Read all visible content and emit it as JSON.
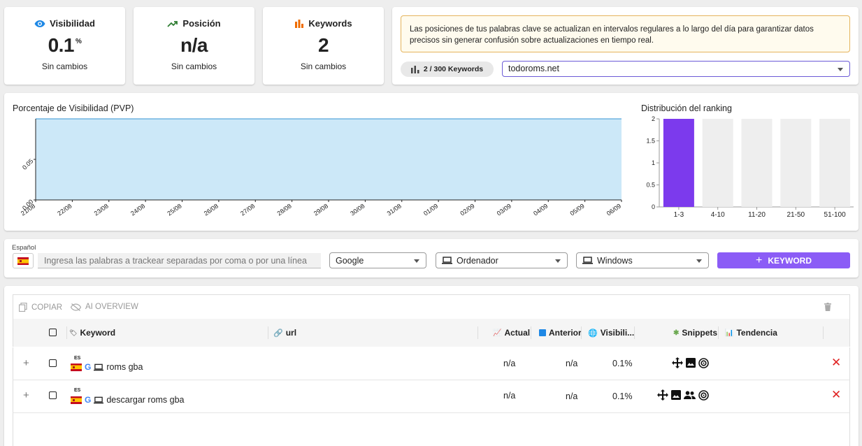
{
  "stats": [
    {
      "title": "Visibilidad",
      "value": "0.1",
      "unit": "%",
      "sub": "Sin cambios",
      "icon": "eye-icon",
      "color": "#1e88e5"
    },
    {
      "title": "Posición",
      "value": "n/a",
      "unit": "",
      "sub": "Sin cambios",
      "icon": "trending-up-icon",
      "color": "#2e7d32"
    },
    {
      "title": "Keywords",
      "value": "2",
      "unit": "",
      "sub": "Sin cambios",
      "icon": "bar-chart-icon",
      "color": "#ef6c00"
    }
  ],
  "notice": "Las posiciones de tus palabras clave se actualizan en intervalos regulares a lo largo del día para garantizar datos precisos sin generar confusión sobre actualizaciones en tiempo real.",
  "keyword_count": "2 / 300 Keywords",
  "domain": "todoroms.net",
  "accent_color": "#8b5cf6",
  "chart_data": [
    {
      "type": "area",
      "title": "Porcentaje de Visibilidad (PVP)",
      "x": [
        "21/08",
        "22/08",
        "23/08",
        "24/08",
        "25/08",
        "26/08",
        "27/08",
        "28/08",
        "29/08",
        "30/08",
        "31/08",
        "01/09",
        "02/09",
        "03/09",
        "04/09",
        "05/09",
        "06/09"
      ],
      "values": [
        0.1,
        0.1,
        0.1,
        0.1,
        0.1,
        0.1,
        0.1,
        0.1,
        0.1,
        0.1,
        0.1,
        0.1,
        0.1,
        0.1,
        0.1,
        0.1,
        0.1
      ],
      "yticks": [
        "0.05",
        "0.00"
      ],
      "ylim": [
        0,
        0.1
      ],
      "fill_color": "#cce8f8",
      "line_color": "#5aa9dc"
    },
    {
      "type": "bar",
      "title": "Distribución del ranking",
      "categories": [
        "1-3",
        "4-10",
        "11-20",
        "21-50",
        "51-100"
      ],
      "values": [
        2,
        0,
        0,
        0,
        0
      ],
      "yticks": [
        "2",
        "1.5",
        "1",
        "0.5",
        "0"
      ],
      "ylim": [
        0,
        2
      ],
      "bar_color": "#7c3aed",
      "bg_color": "#eeeeee"
    }
  ],
  "form": {
    "language_label": "Español",
    "keyword_placeholder": "Ingresa las palabras a trackear separadas por coma o por una línea",
    "engine": "Google",
    "device": "Ordenador",
    "os": "Windows",
    "add_button": "KEYWORD"
  },
  "toolbar": {
    "copy": "COPIAR",
    "ai_overview": "AI OVERVIEW"
  },
  "columns": {
    "keyword": "Keyword",
    "url": "url",
    "actual": "Actual",
    "anterior": "Anterior",
    "visibility": "Visibili...",
    "snippets": "Snippets",
    "trend": "Tendencia"
  },
  "rows": [
    {
      "country": "ES",
      "keyword": "roms gba",
      "actual": "n/a",
      "anterior": "n/a",
      "visibility": "0.1%",
      "snippets": [
        "move-icon",
        "image-icon",
        "disc-icon"
      ]
    },
    {
      "country": "ES",
      "keyword": "descargar roms gba",
      "actual": "n/a",
      "anterior": "n/a",
      "visibility": "0.1%",
      "snippets": [
        "move-icon",
        "image-icon",
        "people-icon",
        "disc-icon"
      ]
    }
  ]
}
